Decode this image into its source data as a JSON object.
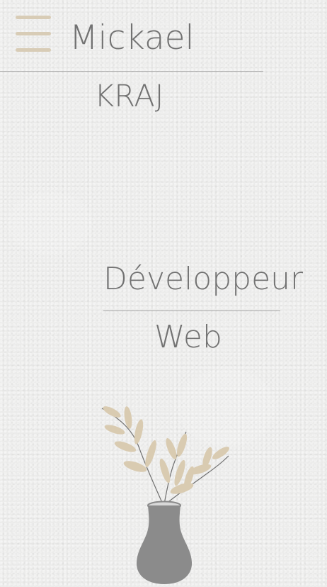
{
  "header": {
    "menu_icon": "hamburger-menu-icon",
    "first_name": "Mickael",
    "last_name": "KRAJ"
  },
  "hero": {
    "role_line_1": "Développeur",
    "role_line_2": "Web"
  },
  "illustration": {
    "icon": "plant-vase-illustration"
  },
  "colors": {
    "background": "#ebebea",
    "text": "#727272",
    "accent_beige": "#d8ccb6",
    "vase_gray": "#8a8a8a"
  }
}
